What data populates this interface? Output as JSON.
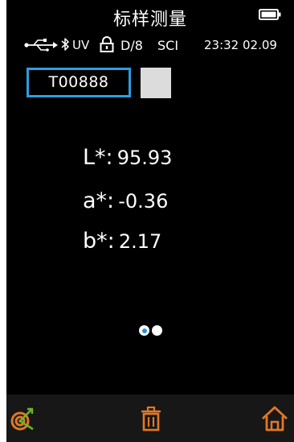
{
  "header": {
    "title": "标样测量",
    "battery_icon": "battery-icon"
  },
  "status": {
    "usb_icon": "usb-icon",
    "bluetooth_icon": "bluetooth-icon",
    "uv": "UV",
    "lock_icon": "lock-icon",
    "geometry": "D/8",
    "mode": "SCI",
    "datetime": "23:32 02.09"
  },
  "sample": {
    "id": "T00888",
    "swatch_color": "#dcdcdc"
  },
  "measurements": [
    {
      "label": "L*:",
      "value": "95.93"
    },
    {
      "label": "a*:",
      "value": "-0.36"
    },
    {
      "label": "b*:",
      "value": "2.17"
    }
  ],
  "pagination": {
    "current_page": 1,
    "total_pages": 2
  },
  "colors": {
    "accent": "#2a9fe0",
    "delete": "#e07828",
    "home": "#e07828",
    "target_orange": "#e07828",
    "target_green": "#6ab62a"
  },
  "bottom_bar": {
    "left_icon": "target-icon",
    "center_icon": "trash-icon",
    "right_icon": "home-icon"
  }
}
